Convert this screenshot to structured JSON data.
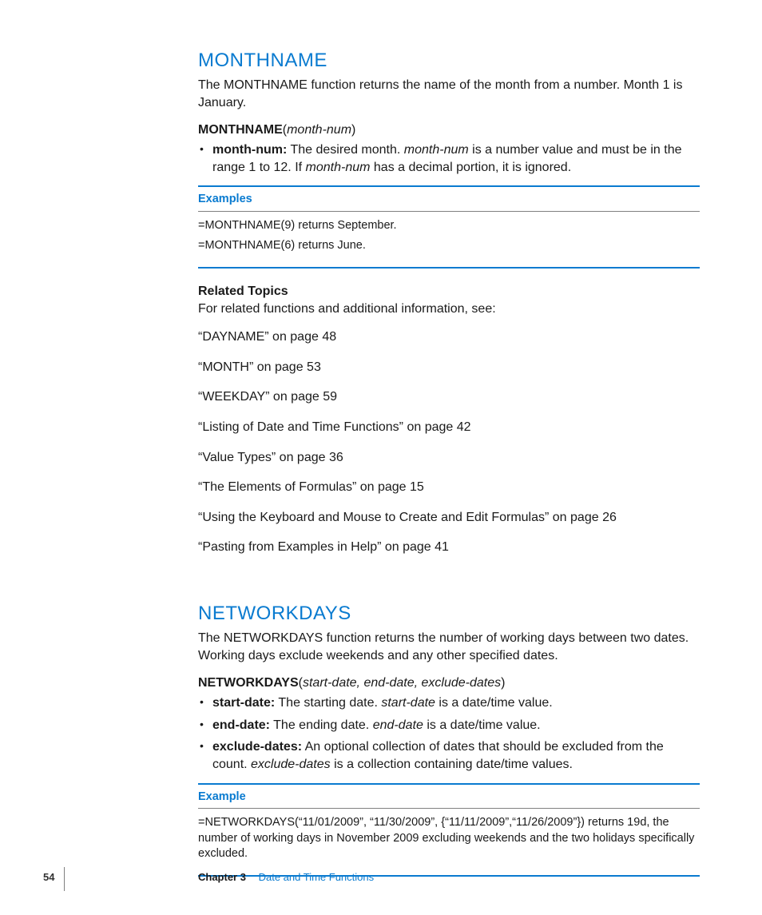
{
  "sections": [
    {
      "title": "MONTHNAME",
      "intro": "The MONTHNAME function returns the name of the month from a number. Month 1 is January.",
      "sig_fn": "MONTHNAME",
      "sig_args": "month-num",
      "params": [
        {
          "name": "month-num:",
          "pre": "  The desired month. ",
          "ital": "month-num",
          "mid": " is a number value and must be in the range 1 to 12. If ",
          "ital2": "month-num",
          "post": " has a decimal portion, it is ignored."
        }
      ],
      "ex_label": "Examples",
      "examples": [
        "=MONTHNAME(9) returns September.",
        "=MONTHNAME(6) returns June."
      ],
      "related_head": "Related Topics",
      "related_intro": "For related functions and additional information, see:",
      "related": [
        "“DAYNAME” on page 48",
        "“MONTH” on page 53",
        "“WEEKDAY” on page 59",
        "“Listing of Date and Time Functions” on page 42",
        "“Value Types” on page 36",
        "“The Elements of Formulas” on page 15",
        "“Using the Keyboard and Mouse to Create and Edit Formulas” on page 26",
        "“Pasting from Examples in Help” on page 41"
      ]
    },
    {
      "title": "NETWORKDAYS",
      "intro": "The NETWORKDAYS function returns the number of working days between two dates. Working days exclude weekends and any other specified dates.",
      "sig_fn": "NETWORKDAYS",
      "sig_args": "start-date, end-date, exclude-dates",
      "params": [
        {
          "name": "start-date:",
          "pre": "  The starting date. ",
          "ital": "start-date",
          "mid": " is a date/time value.",
          "ital2": "",
          "post": ""
        },
        {
          "name": "end-date:",
          "pre": "  The ending date. ",
          "ital": "end-date",
          "mid": " is a date/time value.",
          "ital2": "",
          "post": ""
        },
        {
          "name": "exclude-dates:",
          "pre": "  An optional collection of dates that should be excluded from the count. ",
          "ital": "exclude-dates",
          "mid": " is a collection containing date/time values.",
          "ital2": "",
          "post": ""
        }
      ],
      "ex_label": "Example",
      "examples": [
        "=NETWORKDAYS(“11/01/2009”, “11/30/2009”, {“11/11/2009”,“11/26/2009”}) returns 19d, the number of working days in November 2009 excluding weekends and the two holidays specifically excluded."
      ]
    }
  ],
  "footer": {
    "page": "54",
    "chapter_label": "Chapter 3",
    "chapter_title": "Date and Time Functions"
  }
}
